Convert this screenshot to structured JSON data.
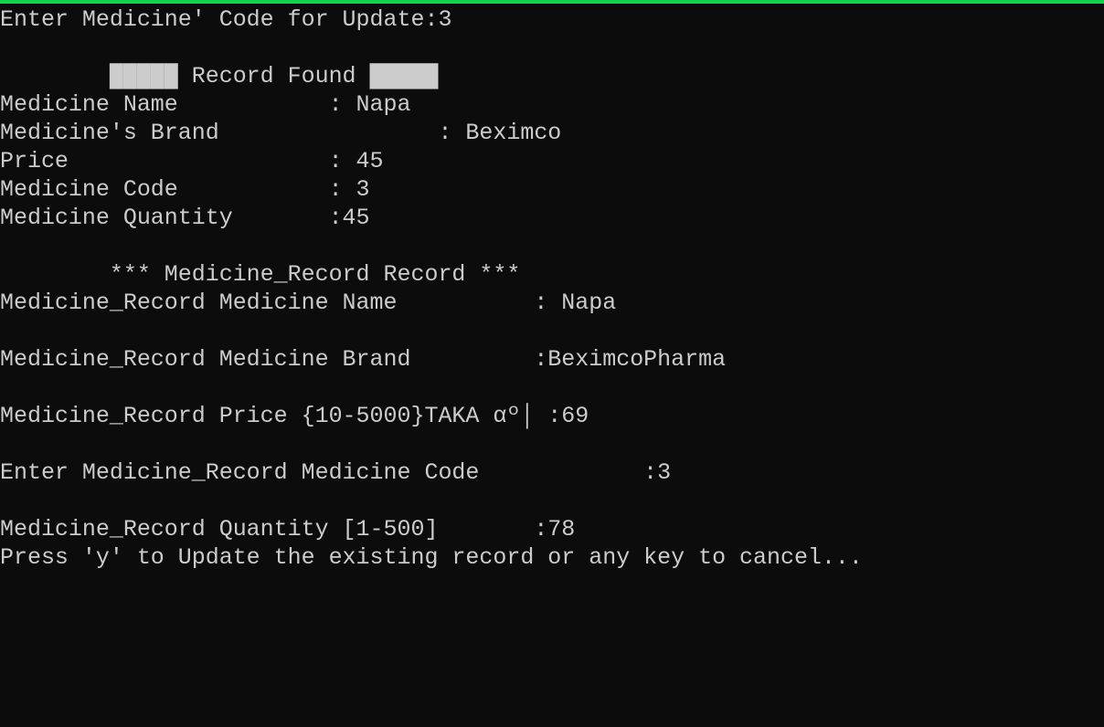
{
  "terminal": {
    "accent_color": "#13d14a",
    "background": "#0c0c0c",
    "foreground": "#cccccc",
    "lines": [
      "Enter Medicine' Code for Update:3",
      "",
      "        █████ Record Found █████",
      "Medicine Name           : Napa",
      "Medicine's Brand                : Beximco",
      "Price                   : 45",
      "Medicine Code           : 3",
      "Medicine Quantity       :45",
      "",
      "        *** Medicine_Record Record ***",
      "Medicine_Record Medicine Name          : Napa",
      "",
      "Medicine_Record Medicine Brand         :BeximcoPharma",
      "",
      "Medicine_Record Price {10-5000}TAKA αº│ :69",
      "",
      "Enter Medicine_Record Medicine Code            :3",
      "",
      "Medicine_Record Quantity [1-500]       :78",
      "Press 'y' to Update the existing record or any key to cancel..."
    ]
  }
}
